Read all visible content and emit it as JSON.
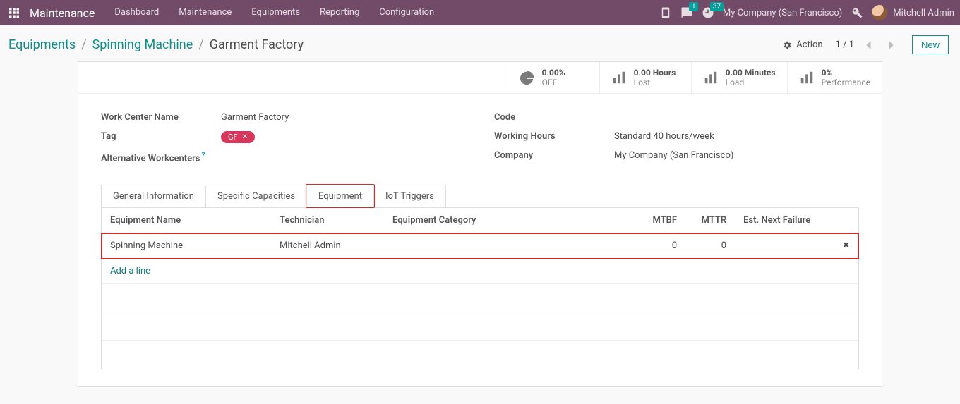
{
  "nav": {
    "brand": "Maintenance",
    "items": [
      "Dashboard",
      "Maintenance",
      "Equipments",
      "Reporting",
      "Configuration"
    ],
    "messages_count": "1",
    "activities_count": "37",
    "company": "My Company (San Francisco)",
    "user": "Mitchell Admin"
  },
  "breadcrumb": {
    "root": "Equipments",
    "mid": "Spinning Machine",
    "current": "Garment Factory"
  },
  "controls": {
    "action_label": "Action",
    "pager": "1 / 1",
    "new_label": "New"
  },
  "stats": [
    {
      "value": "0.00%",
      "label": "OEE",
      "icon": "pie"
    },
    {
      "value": "0.00 Hours",
      "label": "Lost",
      "icon": "bars"
    },
    {
      "value": "0.00 Minutes",
      "label": "Load",
      "icon": "bars"
    },
    {
      "value": "0%",
      "label": "Performance",
      "icon": "bars"
    }
  ],
  "fields": {
    "work_center_name_label": "Work Center Name",
    "work_center_name": "Garment Factory",
    "tag_label": "Tag",
    "tag_value": "GF",
    "alt_wc_label": "Alternative Workcenters",
    "code_label": "Code",
    "code_value": "",
    "working_hours_label": "Working Hours",
    "working_hours": "Standard 40 hours/week",
    "company_label": "Company",
    "company": "My Company (San Francisco)"
  },
  "tabs": [
    "General Information",
    "Specific Capacities",
    "Equipment",
    "IoT Triggers"
  ],
  "active_tab_index": 2,
  "table": {
    "headers": {
      "name": "Equipment Name",
      "technician": "Technician",
      "category": "Equipment Category",
      "mtbf": "MTBF",
      "mttr": "MTTR",
      "next_failure": "Est. Next Failure"
    },
    "row": {
      "name": "Spinning Machine",
      "technician": "Mitchell Admin",
      "category": "",
      "mtbf": "0",
      "mttr": "0",
      "next_failure": ""
    },
    "add_line": "Add a line"
  }
}
